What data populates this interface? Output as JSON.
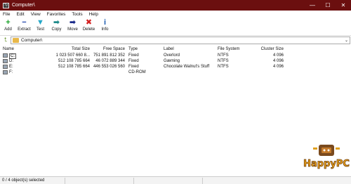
{
  "window": {
    "title": "Computer\\",
    "app_icon_glyph": "7z",
    "controls": [
      "—",
      "☐",
      "✕"
    ],
    "title_color": "#6b0f0f"
  },
  "menu": [
    "File",
    "Edit",
    "View",
    "Favorites",
    "Tools",
    "Help"
  ],
  "toolbar": [
    {
      "label": "Add",
      "glyph": "+",
      "icon": "add-icon",
      "color": "#1aa32a"
    },
    {
      "label": "Extract",
      "glyph": "−",
      "icon": "extract-icon",
      "color": "#1a3ea8"
    },
    {
      "label": "Test",
      "glyph": "▼",
      "icon": "test-icon",
      "color": "#25a8c8"
    },
    {
      "label": "Copy",
      "glyph": "➡",
      "icon": "copy-icon",
      "color": "#1e8a8a"
    },
    {
      "label": "Move",
      "glyph": "➡",
      "icon": "move-icon",
      "color": "#1a2a8a"
    },
    {
      "label": "Delete",
      "glyph": "✖",
      "icon": "delete-icon",
      "color": "#d42020"
    },
    {
      "label": "Info",
      "glyph": "i",
      "icon": "info-icon",
      "color": "#1a5ab0"
    }
  ],
  "address": {
    "path": "Computer\\"
  },
  "columns": {
    "name": "Name",
    "total": "Total Size",
    "free": "Free Space",
    "type": "Type",
    "label": "Label",
    "fs": "File System",
    "cluster": "Cluster Size"
  },
  "rows": [
    {
      "name": "C:",
      "total": "1 023 507 660 8...",
      "free": "751 891 812 352",
      "type": "Fixed",
      "label": "Overlord",
      "fs": "NTFS",
      "cluster": "4 096"
    },
    {
      "name": "D:",
      "total": "512 108 785 664",
      "free": "46 072 889 344",
      "type": "Fixed",
      "label": "Gæming",
      "fs": "NTFS",
      "cluster": "4 096"
    },
    {
      "name": "E:",
      "total": "512 108 785 664",
      "free": "446 553 026 560",
      "type": "Fixed",
      "label": "Chocolate Walnut's Stuff",
      "fs": "NTFS",
      "cluster": "4 096"
    },
    {
      "name": "F:",
      "total": "",
      "free": "",
      "type": "CD-ROM",
      "label": "",
      "fs": "",
      "cluster": ""
    }
  ],
  "status": {
    "text": "0 / 4 object(s) selected"
  },
  "watermark": {
    "text": "HappyPC"
  }
}
